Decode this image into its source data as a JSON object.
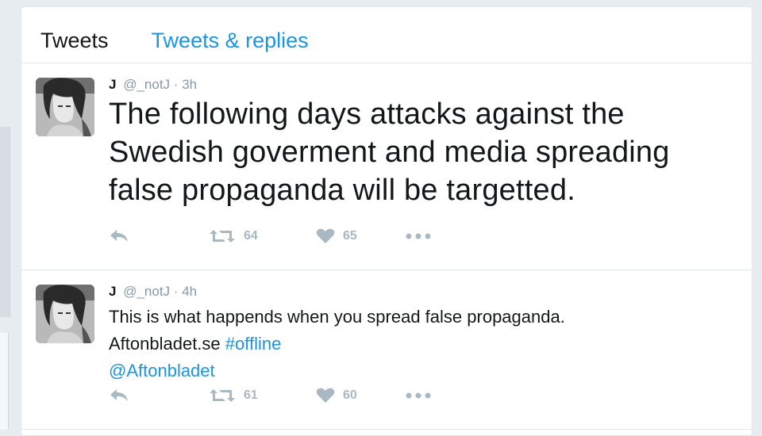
{
  "tabs": [
    {
      "label": "Tweets"
    },
    {
      "label": "Tweets & replies"
    }
  ],
  "tweets": [
    {
      "name": "J",
      "handle": "@_notJ",
      "sep": "·",
      "time": "3h",
      "text": "The following days attacks against the Swedish goverment and media spreading false propaganda will be targetted.",
      "retweets": "64",
      "likes": "65"
    },
    {
      "name": "J",
      "handle": "@_notJ",
      "sep": "·",
      "time": "4h",
      "line1": "This is what happends when you spread false propaganda.",
      "line2_text": "Aftonbladet.se",
      "line2_hashtag": "#offline",
      "line3_mention": "@Aftonbladet",
      "retweets": "61",
      "likes": "60"
    }
  ],
  "colors": {
    "link": "#1b95e0",
    "icon": "#aab8c2",
    "text": "#14171a",
    "muted": "#8899a6"
  },
  "icons": [
    "reply-icon",
    "retweet-icon",
    "heart-icon",
    "more-icon"
  ]
}
